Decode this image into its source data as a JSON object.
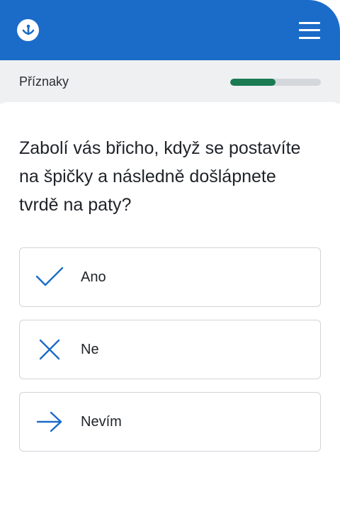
{
  "header": {
    "logo_icon": "anchor-logo-icon",
    "menu_icon": "hamburger-menu-icon",
    "background_color": "#1b6bc8"
  },
  "subheader": {
    "section_label": "Příznaky",
    "progress_fraction": 0.5,
    "progress_color": "#1b7a52"
  },
  "question": {
    "text": "Zabolí vás břicho, když se postavíte na špičky a následně došlápnete tvrdě na paty?"
  },
  "answers": [
    {
      "label": "Ano",
      "icon": "check-icon"
    },
    {
      "label": "Ne",
      "icon": "cross-icon"
    },
    {
      "label": "Nevím",
      "icon": "arrow-right-icon"
    }
  ],
  "accent_color": "#1b6bc8"
}
